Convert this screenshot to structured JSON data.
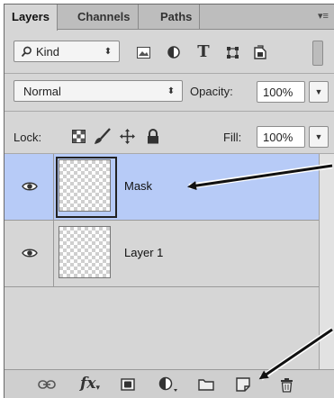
{
  "tabs": [
    {
      "label": "Layers",
      "active": true
    },
    {
      "label": "Channels",
      "active": false
    },
    {
      "label": "Paths",
      "active": false
    }
  ],
  "filter": {
    "kind_label": "Kind",
    "icons": [
      "search-icon",
      "image-filter-icon",
      "adjustment-filter-icon",
      "type-filter-icon",
      "shape-filter-icon",
      "smart-object-filter-icon"
    ]
  },
  "blend": {
    "mode": "Normal",
    "opacity_label": "Opacity:",
    "opacity_value": "100%"
  },
  "lock": {
    "label": "Lock:",
    "icons": [
      "lock-transparent-icon",
      "lock-image-icon",
      "lock-position-icon",
      "lock-all-icon"
    ],
    "fill_label": "Fill:",
    "fill_value": "100%"
  },
  "layers": [
    {
      "name": "Mask",
      "visible": true,
      "selected": true
    },
    {
      "name": "Layer 1",
      "visible": true,
      "selected": false
    }
  ],
  "bottom_icons": [
    "link-icon",
    "fx-icon",
    "mask-icon",
    "adjustment-layer-icon",
    "folder-icon",
    "new-layer-icon",
    "trash-icon"
  ],
  "colors": {
    "panel": "#d6d6d6",
    "selected": "#b7cbf7"
  }
}
